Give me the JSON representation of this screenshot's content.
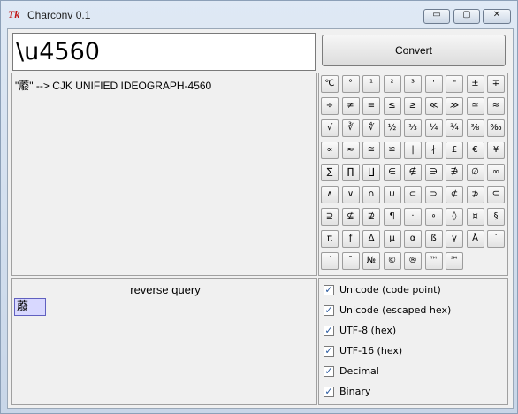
{
  "window": {
    "title": "Charconv 0.1",
    "icon": "tk-icon",
    "icon_text": "Tk",
    "controls": {
      "minimize": "▭",
      "maximize": "▢",
      "close": "✕"
    }
  },
  "input": {
    "value": "\\u4560"
  },
  "convert": {
    "label": "Convert"
  },
  "output": {
    "line": "\"䕠\" --> CJK UNIFIED IDEOGRAPH-4560"
  },
  "char_buttons": [
    [
      "℃",
      "°",
      "¹",
      "²",
      "³",
      "'",
      "\"",
      "±",
      "∓"
    ],
    [
      "÷",
      "≠",
      "≡",
      "≤",
      "≥",
      "≪",
      "≫",
      "≃",
      "≈"
    ],
    [
      "√",
      "∛",
      "∜",
      "½",
      "⅓",
      "¼",
      "¾",
      "⅜",
      "‰"
    ],
    [
      "∝",
      "≈",
      "≅",
      "≌",
      "|",
      "∤",
      "£",
      "€",
      "¥"
    ],
    [
      "∑",
      "∏",
      "∐",
      "∈",
      "∉",
      "∋",
      "∌",
      "∅",
      "∞"
    ],
    [
      "∧",
      "∨",
      "∩",
      "∪",
      "⊂",
      "⊃",
      "⊄",
      "⊅",
      "⊆"
    ],
    [
      "⊇",
      "⊈",
      "⊉",
      "¶",
      "·",
      "∘",
      "◊",
      "¤",
      "§"
    ],
    [
      "π",
      "ƒ",
      "Δ",
      "μ",
      "α",
      "ß",
      "γ",
      "Å",
      "´"
    ],
    [
      "ˊ",
      "¯",
      "№",
      "©",
      "®",
      "™",
      "℠"
    ]
  ],
  "reverse": {
    "label": "reverse query",
    "value": "䕠"
  },
  "options": [
    {
      "label": "Unicode (code point)",
      "checked": true
    },
    {
      "label": "Unicode (escaped hex)",
      "checked": true
    },
    {
      "label": "UTF-8 (hex)",
      "checked": true
    },
    {
      "label": "UTF-16 (hex)",
      "checked": true
    },
    {
      "label": "Decimal",
      "checked": true
    },
    {
      "label": "Binary",
      "checked": true
    }
  ]
}
